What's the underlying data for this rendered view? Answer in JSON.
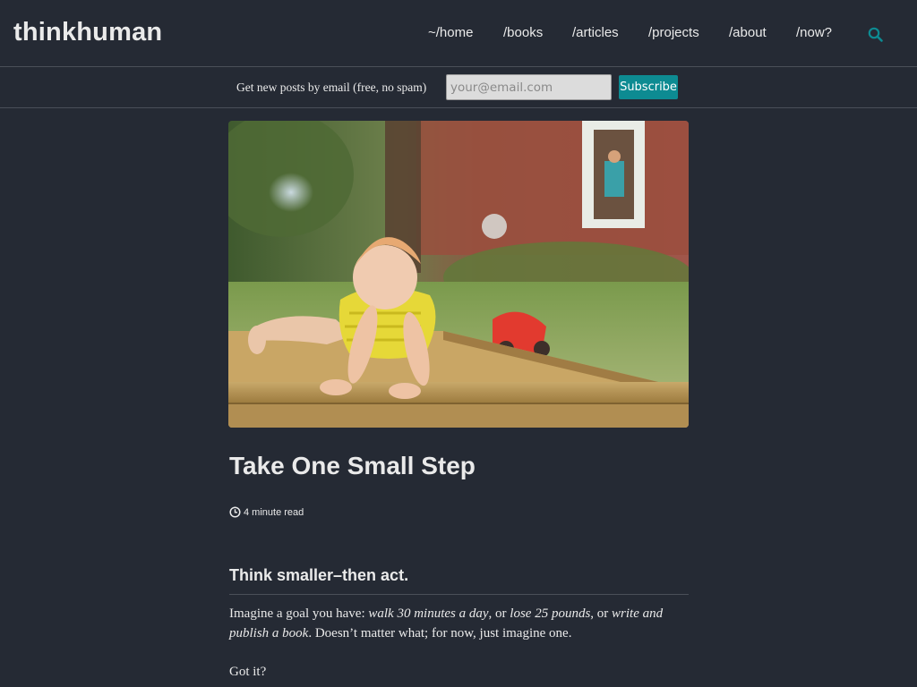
{
  "site": {
    "title": "thinkhuman"
  },
  "nav": {
    "items": [
      {
        "label": "~/home"
      },
      {
        "label": "/books"
      },
      {
        "label": "/articles"
      },
      {
        "label": "/projects"
      },
      {
        "label": "/about"
      },
      {
        "label": "/now?"
      }
    ],
    "search_icon": "search-icon"
  },
  "subscribe": {
    "label": "Get new posts by email (free, no spam)",
    "placeholder": "your@email.com",
    "button_label": "Subscribe"
  },
  "post": {
    "hero_image": "baby-climbing-out-of-sandbox-photo",
    "title": "Take One Small Step",
    "read_time": "4 minute read",
    "read_time_icon": "clock-icon",
    "section_heading": "Think smaller–then act.",
    "p1": {
      "s1": "Imagine a goal you have: ",
      "e1": "walk 30 minutes a day",
      "s2": ", or ",
      "e2": "lose 25 pounds",
      "s3": ", or ",
      "e3": "write and publish a book",
      "s4": ". Doesn’t matter what; for now, just imagine one."
    },
    "p2": "Got it?"
  },
  "colors": {
    "background": "#252a34",
    "accent": "#0d8b92",
    "text": "#eaeaea"
  }
}
